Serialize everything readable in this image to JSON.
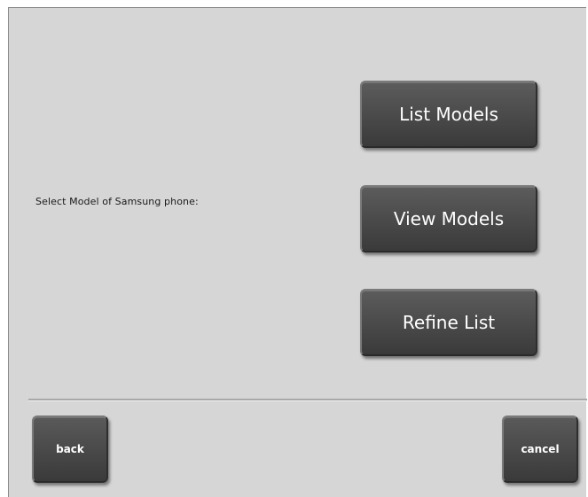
{
  "prompt": {
    "text": "Select Model of Samsung phone:"
  },
  "actions": {
    "list_models": "List Models",
    "view_models": "View Models",
    "refine_list": "Refine List"
  },
  "footer": {
    "back": "back",
    "cancel": "cancel"
  },
  "colors": {
    "background": "#d6d6d6",
    "button": "#4a4a4a",
    "button_text": "#ffffff"
  }
}
